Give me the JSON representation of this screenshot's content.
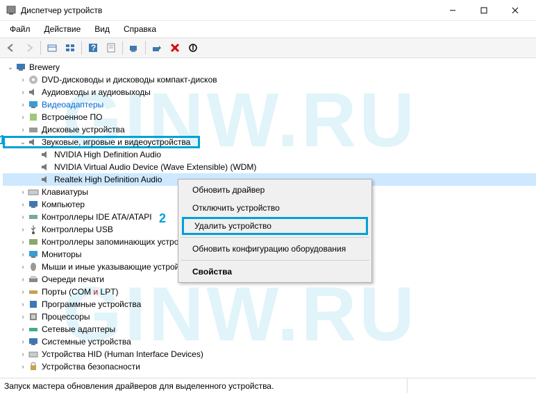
{
  "window": {
    "title": "Диспетчер устройств"
  },
  "menu": {
    "file": "Файл",
    "action": "Действие",
    "view": "Вид",
    "help": "Справка"
  },
  "root": "Brewery",
  "annot": {
    "n1": "1",
    "n2": "2"
  },
  "cat": {
    "dvd": "DVD-дисководы и дисководы компакт-дисков",
    "audio_io": "Аудиовходы и аудиовыходы",
    "video": "Видеоадаптеры",
    "firmware": "Встроенное ПО",
    "disk": "Дисковые устройства",
    "sound": "Звуковые, игровые и видеоустройства",
    "nv_hda": "NVIDIA High Definition Audio",
    "nv_vad": "NVIDIA Virtual Audio Device (Wave Extensible) (WDM)",
    "realtek": "Realtek High Definition Audio",
    "keyboards": "Клавиатуры",
    "computer": "Компьютер",
    "ide": "Контроллеры IDE ATA/ATAPI",
    "usb": "Контроллеры USB",
    "storage": "Контроллеры запоминающих устройств",
    "monitors": "Мониторы",
    "mice": "Мыши и иные указывающие устройства",
    "printq": "Очереди печати",
    "ports_a": "Порты (COM ",
    "ports_b": "и",
    "ports_c": " LPT)",
    "software": "Программные устройства",
    "cpu": "Процессоры",
    "net": "Сетевые адаптеры",
    "system": "Системные устройства",
    "hid": "Устройства HID (Human Interface Devices)",
    "security": "Устройства безопасности"
  },
  "ctx": {
    "update": "Обновить драйвер",
    "disable": "Отключить устройство",
    "delete": "Удалить устройство",
    "rescan": "Обновить конфигурацию оборудования",
    "props": "Свойства"
  },
  "status": "Запуск мастера обновления драйверов для выделенного устройства.",
  "watermark": "GINW.RU"
}
